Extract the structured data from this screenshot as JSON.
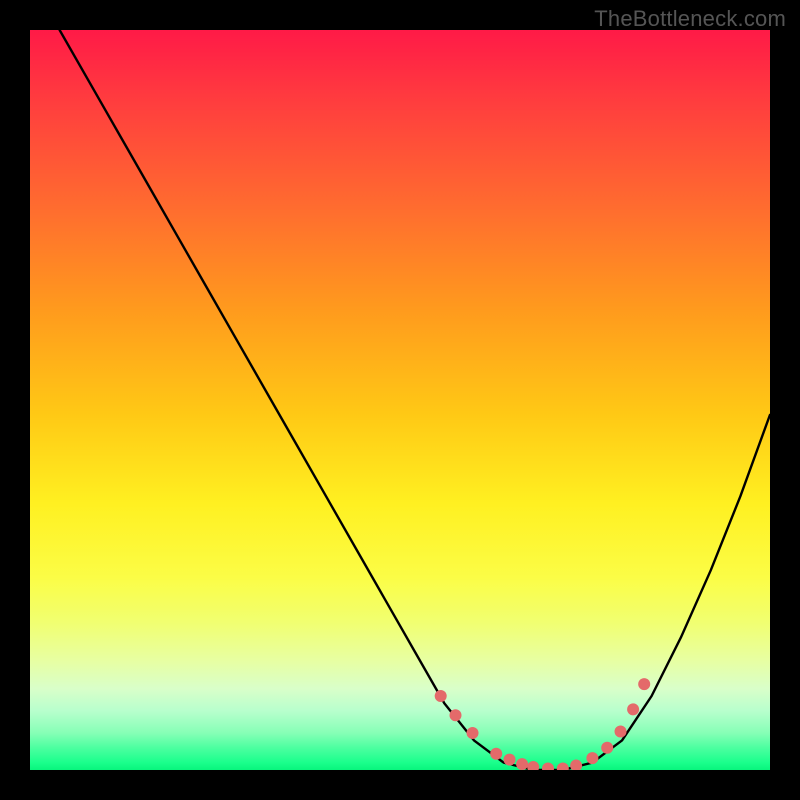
{
  "watermark": "TheBottleneck.com",
  "chart_data": {
    "type": "line",
    "title": "",
    "xlabel": "",
    "ylabel": "",
    "xlim": [
      0,
      100
    ],
    "ylim": [
      0,
      100
    ],
    "grid": false,
    "series": [
      {
        "name": "curve",
        "x": [
          4,
          8,
          12,
          16,
          20,
          24,
          28,
          32,
          36,
          40,
          44,
          48,
          52,
          56,
          60,
          64,
          68,
          72,
          76,
          80,
          84,
          88,
          92,
          96,
          100
        ],
        "y": [
          100,
          93,
          86,
          79,
          72,
          65,
          58,
          51,
          44,
          37,
          30,
          23,
          16,
          9,
          4,
          1,
          0,
          0,
          1,
          4,
          10,
          18,
          27,
          37,
          48
        ]
      }
    ],
    "markers": {
      "name": "highlight-points",
      "x": [
        55.5,
        57.5,
        59.8,
        63.0,
        64.8,
        66.5,
        68.0,
        70.0,
        72.0,
        73.8,
        76.0,
        78.0,
        79.8,
        81.5,
        83.0
      ],
      "y": [
        10.0,
        7.4,
        5.0,
        2.2,
        1.4,
        0.8,
        0.4,
        0.2,
        0.2,
        0.6,
        1.6,
        3.0,
        5.2,
        8.2,
        11.6
      ],
      "color": "#e46a6a",
      "radius": 6
    },
    "gradient_stops": [
      {
        "pos": 0.0,
        "color": "#ff1a47"
      },
      {
        "pos": 0.24,
        "color": "#ff6c2f"
      },
      {
        "pos": 0.52,
        "color": "#ffc915"
      },
      {
        "pos": 0.74,
        "color": "#fbfd46"
      },
      {
        "pos": 0.92,
        "color": "#b8ffcd"
      },
      {
        "pos": 1.0,
        "color": "#08f57d"
      }
    ]
  }
}
